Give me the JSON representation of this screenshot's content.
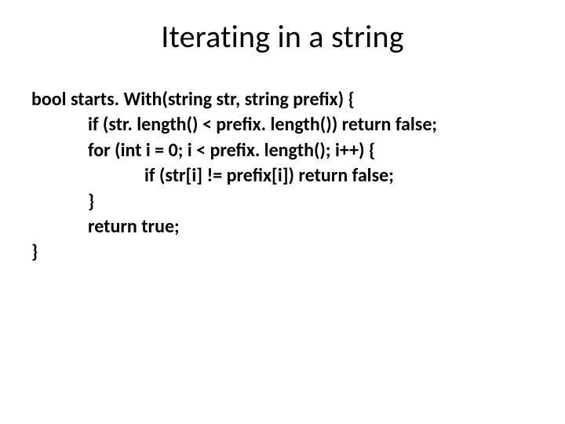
{
  "title": "Iterating in a string",
  "code": {
    "l1": "bool starts. With(string str, string prefix) {",
    "l2": "if (str. length() < prefix. length()) return false;",
    "l3": "for (int i = 0; i < prefix. length(); i++) {",
    "l4": "if (str[i] != prefix[i]) return false;",
    "l5": "}",
    "l6": "return true;",
    "l7": "}"
  }
}
